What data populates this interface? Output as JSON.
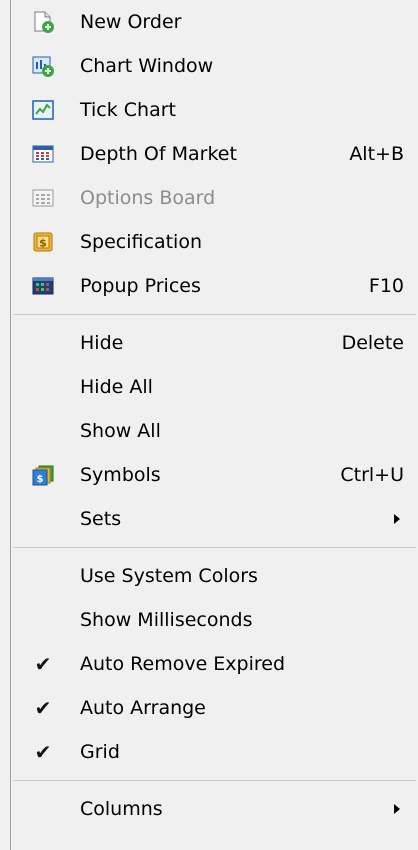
{
  "menu": {
    "new_order": {
      "label": "New Order",
      "icon": "new-order-icon"
    },
    "chart_window": {
      "label": "Chart Window",
      "icon": "chart-window-icon"
    },
    "tick_chart": {
      "label": "Tick Chart",
      "icon": "tick-chart-icon"
    },
    "depth_of_market": {
      "label": "Depth Of Market",
      "shortcut": "Alt+B",
      "icon": "depth-of-market-icon"
    },
    "options_board": {
      "label": "Options Board",
      "icon": "options-board-icon",
      "disabled": true
    },
    "specification": {
      "label": "Specification",
      "icon": "specification-icon"
    },
    "popup_prices": {
      "label": "Popup Prices",
      "shortcut": "F10",
      "icon": "popup-prices-icon"
    },
    "hide": {
      "label": "Hide",
      "shortcut": "Delete"
    },
    "hide_all": {
      "label": "Hide All"
    },
    "show_all": {
      "label": "Show All"
    },
    "symbols": {
      "label": "Symbols",
      "shortcut": "Ctrl+U",
      "icon": "symbols-icon"
    },
    "sets": {
      "label": "Sets",
      "submenu": true
    },
    "use_system_colors": {
      "label": "Use System Colors",
      "checked": false
    },
    "show_milliseconds": {
      "label": "Show Milliseconds",
      "checked": false
    },
    "auto_remove_expired": {
      "label": "Auto Remove Expired",
      "checked": true
    },
    "auto_arrange": {
      "label": "Auto Arrange",
      "checked": true
    },
    "grid": {
      "label": "Grid",
      "checked": true
    },
    "columns": {
      "label": "Columns",
      "submenu": true
    }
  },
  "colors": {
    "background": "#f0f0f0",
    "separator": "#c8c8c8",
    "disabled_text": "#8c8c8c",
    "icon_green": "#3aa83a",
    "icon_blue": "#1f5fb8",
    "icon_orange": "#e8a51a"
  }
}
